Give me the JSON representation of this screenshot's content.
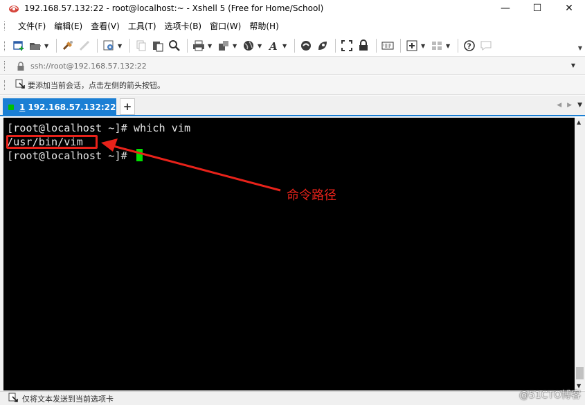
{
  "window": {
    "title": "192.168.57.132:22 - root@localhost:~ - Xshell 5 (Free for Home/School)",
    "minimize": "—",
    "maximize": "☐",
    "close": "✕"
  },
  "menu": {
    "items": [
      "文件(F)",
      "编辑(E)",
      "查看(V)",
      "工具(T)",
      "选项卡(B)",
      "窗口(W)",
      "帮助(H)"
    ]
  },
  "toolbar": {
    "icons": [
      "new-session-icon",
      "open-folder-icon",
      "connect-icon",
      "disconnect-icon",
      "properties-icon",
      "copy-icon",
      "paste-icon",
      "find-icon",
      "print-icon",
      "transfer-icon",
      "globe-icon",
      "font-icon",
      "xftp-icon",
      "xmanager-icon",
      "fullscreen-icon",
      "lock-icon",
      "keyboard-icon",
      "add-tab-icon",
      "layout-icon",
      "help-icon",
      "chat-icon"
    ]
  },
  "address": {
    "value": "ssh://root@192.168.57.132:22"
  },
  "hint": {
    "text": "要添加当前会话，点击左侧的箭头按钮。"
  },
  "tabs": {
    "active": {
      "number": "1",
      "label": "192.168.57.132:22",
      "status_color": "#00c000"
    },
    "add_label": "+",
    "nav_prev": "◀",
    "nav_next": "▶",
    "nav_menu": "▼"
  },
  "terminal": {
    "lines": [
      "[root@localhost ~]# which vim",
      "/usr/bin/vim",
      "[root@localhost ~]# "
    ],
    "cursor_color": "#00e000"
  },
  "annotation": {
    "label": "命令路径",
    "color": "#e8221a"
  },
  "status": {
    "text": "仅将文本发送到当前选项卡"
  },
  "watermark": {
    "text": "@51CTO博客"
  },
  "colors": {
    "accent": "#1b7fd4",
    "terminal_bg": "#000000",
    "terminal_fg": "#e6e6e6"
  }
}
